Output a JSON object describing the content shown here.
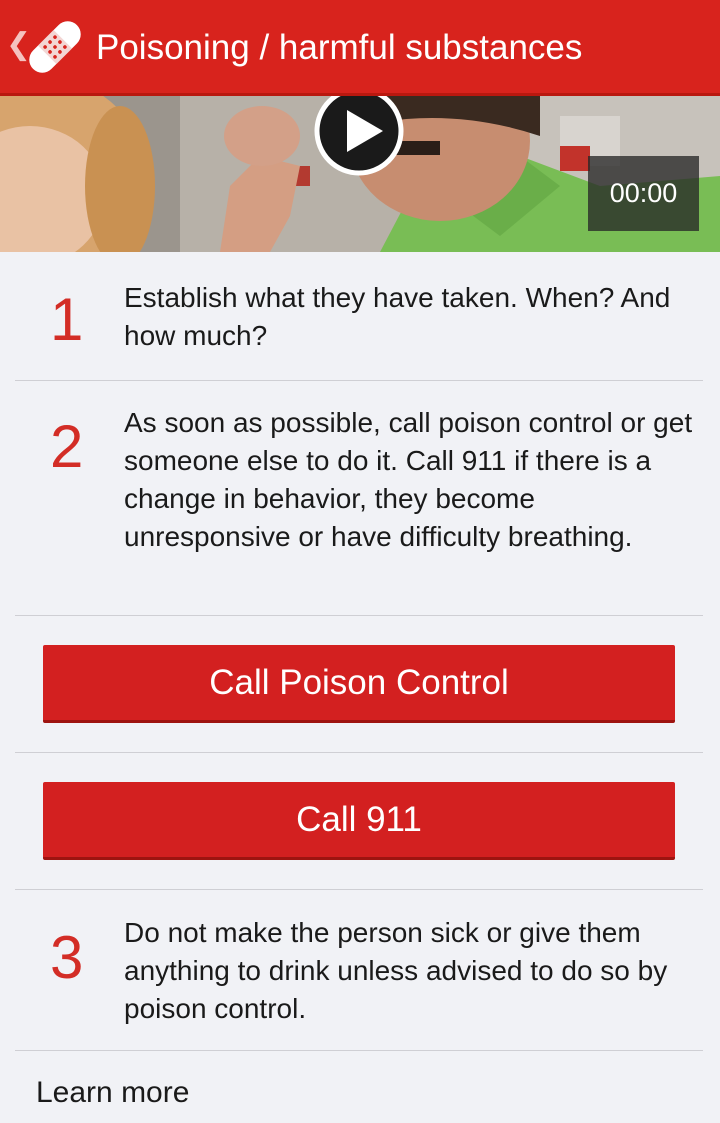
{
  "appbar": {
    "title": "Poisoning / harmful substances",
    "back_icon": "chevron-left-icon",
    "logo_icon": "bandage-icon"
  },
  "video": {
    "time": "00:00",
    "play_icon": "play-icon"
  },
  "steps": [
    {
      "number": "1",
      "text": "Establish what they have taken. When? And how much?"
    },
    {
      "number": "2",
      "text": "As soon as possible, call poison control or get someone else to do it. Call 911 if there is a change in behavior, they become unresponsive or have difficulty breathing."
    },
    {
      "number": "3",
      "text": "Do not make the person sick or give them anything to drink unless advised to do so by poison control."
    }
  ],
  "buttons": {
    "poison_control": "Call Poison Control",
    "call_911": "Call 911"
  },
  "footer": {
    "learn_more": "Learn more"
  },
  "colors": {
    "brand_red": "#d8231d",
    "step_number": "#d32d26",
    "background": "#f1f2f6"
  }
}
